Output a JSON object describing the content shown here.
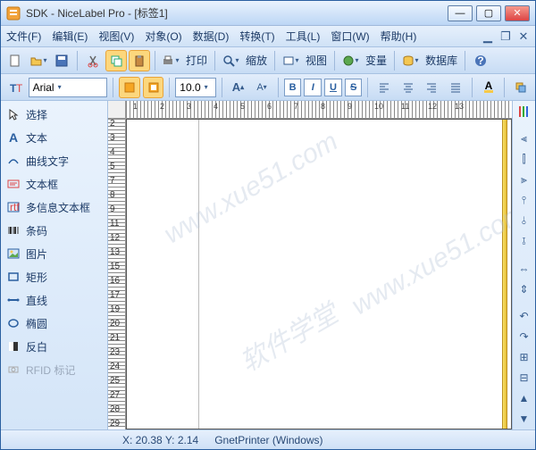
{
  "titlebar": {
    "app": "SDK - NiceLabel Pro -",
    "doc": " [标签1]"
  },
  "menus": {
    "file": "文件(F)",
    "edit": "编辑(E)",
    "view": "视图(V)",
    "object": "对象(O)",
    "data": "数据(D)",
    "convert": "转换(T)",
    "tools": "工具(L)",
    "window": "窗口(W)",
    "help": "帮助(H)"
  },
  "toolbar": {
    "print": "打印",
    "zoom": "缩放",
    "view": "视图",
    "var": "变量",
    "db": "数据库"
  },
  "font": {
    "name": "Arial",
    "size": "10.0"
  },
  "toolbox": {
    "select": "选择",
    "text": "文本",
    "curvetext": "曲线文字",
    "textbox": "文本框",
    "multiline": "多信息文本框",
    "barcode": "条码",
    "image": "图片",
    "rect": "矩形",
    "line": "直线",
    "ellipse": "椭圆",
    "inverse": "反白",
    "rfid": "RFID 标记"
  },
  "status": {
    "coords": "X: 20.38 Y: 2.14",
    "printer": "GnetPrinter (Windows)"
  },
  "ruler": {
    "h": [
      "1",
      "2",
      "3",
      "4",
      "5",
      "6",
      "7",
      "8",
      "9",
      "10",
      "11",
      "12",
      "13"
    ],
    "v": [
      "2",
      "3",
      "4",
      "5",
      "7",
      "8",
      "9",
      "11",
      "12",
      "13",
      "15",
      "16",
      "17",
      "19",
      "20",
      "21",
      "23",
      "24",
      "25",
      "27",
      "28",
      "29"
    ]
  },
  "watermark": "软件学堂"
}
